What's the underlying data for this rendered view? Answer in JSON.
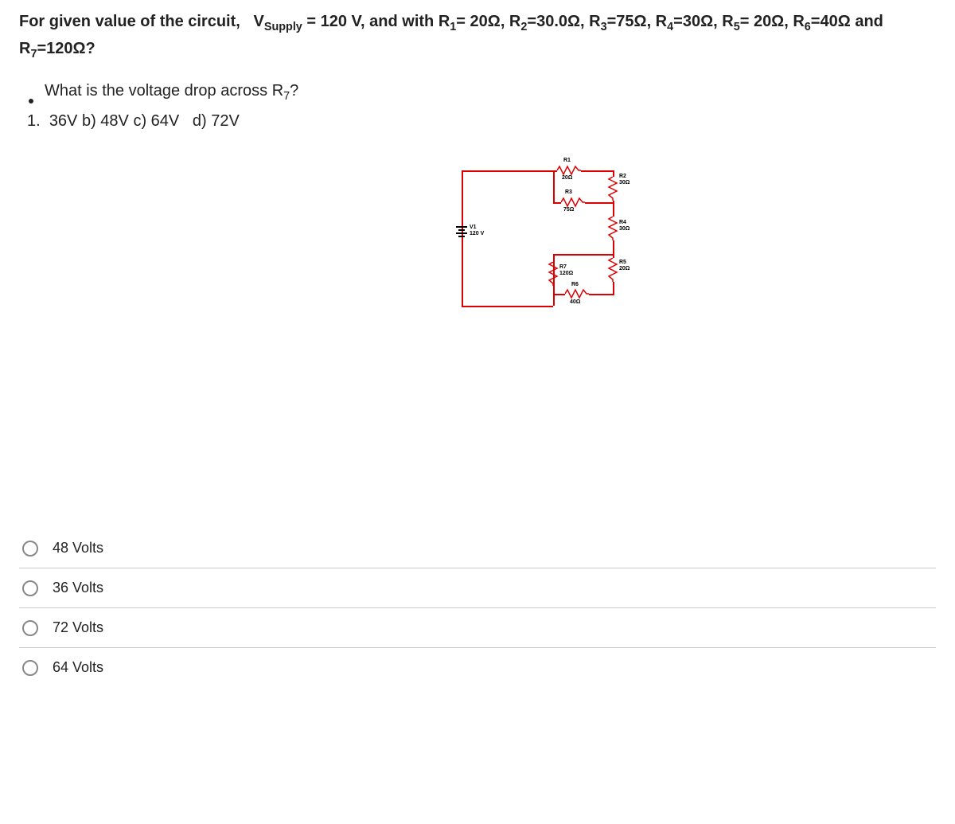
{
  "question": {
    "prompt_html": "For given value of the circuit,   V<sub>Supply</sub> = 120 V, and with R<sub>1</sub>= 20Ω, R<sub>2</sub>=30.0Ω, R<sub>3</sub>=75Ω, R<sub>4</sub>=30Ω, R<sub>5</sub>= 20Ω, R<sub>6</sub>=40Ω and R<sub>7</sub>=120Ω?",
    "sub_question_html": "What is the voltage drop across R<sub>7</sub>?",
    "inline_options": "36V b) 48V c) 64V   d) 72V",
    "inline_prefix": "1."
  },
  "circuit": {
    "source": {
      "name": "V1",
      "value": "120 V"
    },
    "R1": {
      "name": "R1",
      "value": "20Ω"
    },
    "R2": {
      "name": "R2",
      "value": "30Ω"
    },
    "R3": {
      "name": "R3",
      "value": "75Ω"
    },
    "R4": {
      "name": "R4",
      "value": "30Ω"
    },
    "R5": {
      "name": "R5",
      "value": "20Ω"
    },
    "R6": {
      "name": "R6",
      "value": "40Ω"
    },
    "R7": {
      "name": "R7",
      "value": "120Ω"
    }
  },
  "choices": [
    "48 Volts",
    "36 Volts",
    "72 Volts",
    "64 Volts"
  ]
}
